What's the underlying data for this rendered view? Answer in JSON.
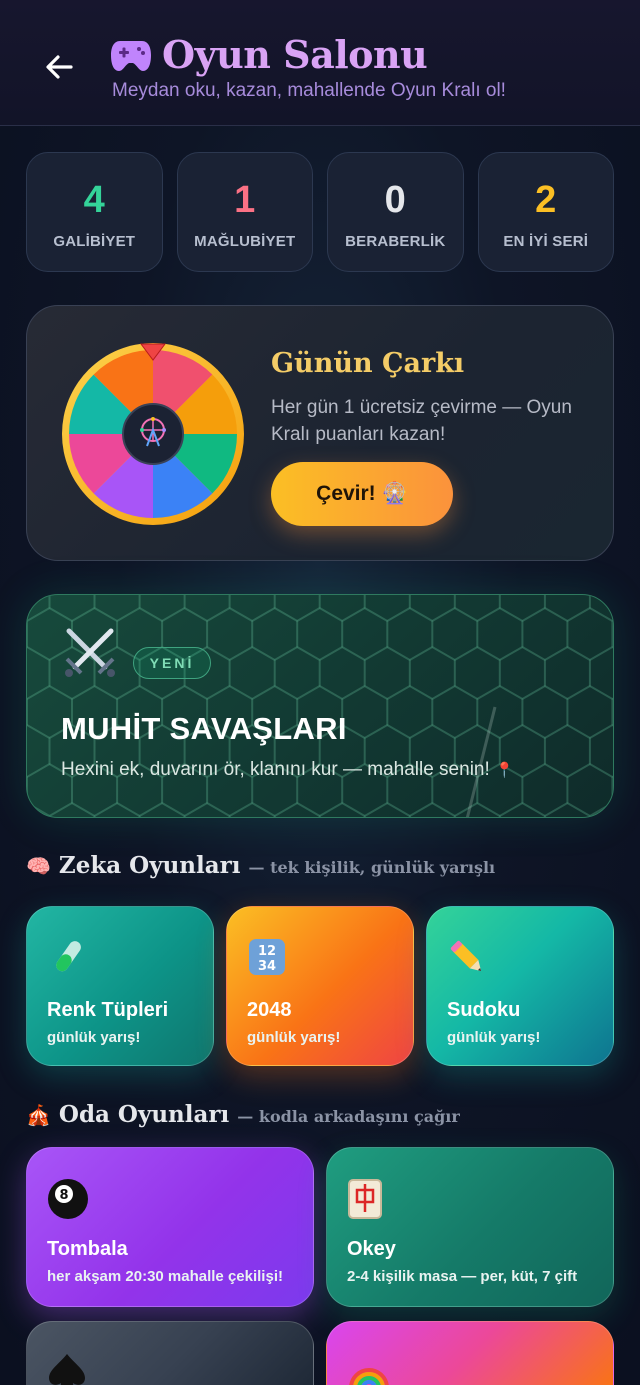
{
  "header": {
    "title": "Oyun Salonu",
    "subtitle": "Meydan oku, kazan, mahallende Oyun Kralı ol!",
    "icons": {
      "back": "arrow-left-icon",
      "logo": "gamepad-icon"
    }
  },
  "stats": [
    {
      "value": "4",
      "label": "GALİBİYET",
      "color": "#34d399"
    },
    {
      "value": "1",
      "label": "MAĞLUBİYET",
      "color": "#fb7185"
    },
    {
      "value": "0",
      "label": "BERABERLİK",
      "color": "#e5e7eb"
    },
    {
      "value": "2",
      "label": "EN İYİ SERİ",
      "color": "#fbbf24"
    }
  ],
  "wheel": {
    "title": "Günün Çarkı",
    "description": "Her gün 1 ücretsiz çevirme — Oyun Kralı puanları kazan!",
    "button_label": "Çevir!",
    "icon": "ferris-wheel-icon",
    "segment_colors": [
      "#f0506e",
      "#f59e0b",
      "#10b981",
      "#3b82f6",
      "#a855f7",
      "#ec4899",
      "#14b8a6",
      "#f97316"
    ]
  },
  "muhit": {
    "badge": "YENİ",
    "title": "MUHİT SAVAŞLARI",
    "description": "Hexini ek, duvarını ör, klanını kur — mahalle senin!",
    "icon": "crossed-swords-icon"
  },
  "zeka": {
    "emoji": "🧠",
    "title": "Zeka Oyunları",
    "subtitle": "— tek kişilik, günlük yarışlı",
    "games": [
      {
        "name": "Renk Tüpleri",
        "sub": "günlük yarış!",
        "icon": "test-tube-icon"
      },
      {
        "name": "2048",
        "sub": "günlük yarış!",
        "icon": "numbers-icon"
      },
      {
        "name": "Sudoku",
        "sub": "günlük yarış!",
        "icon": "pencil-icon"
      }
    ]
  },
  "oda": {
    "emoji": "🎪",
    "title": "Oda Oyunları",
    "subtitle": "— kodla arkadaşını çağır",
    "games": [
      {
        "name": "Tombala",
        "sub": "her akşam 20:30 mahalle çekilişi!",
        "icon": "eight-ball-icon"
      },
      {
        "name": "Okey",
        "sub": "2-4 kişilik masa — per, küt, 7 çift",
        "icon": "mahjong-tile-icon"
      },
      {
        "name": "",
        "sub": "",
        "icon": "spade-icon"
      },
      {
        "name": "",
        "sub": "",
        "icon": "rainbow-icon"
      }
    ]
  }
}
